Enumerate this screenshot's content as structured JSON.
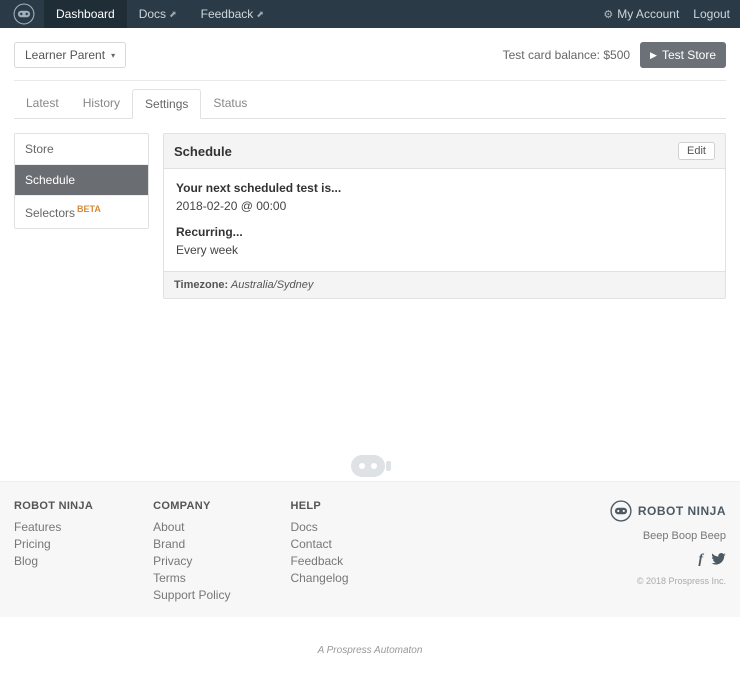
{
  "nav": {
    "dashboard": "Dashboard",
    "docs": "Docs",
    "feedback": "Feedback",
    "my_account": "My Account",
    "logout": "Logout"
  },
  "toprow": {
    "store_selector": "Learner Parent",
    "balance_label": "Test card balance: $500",
    "test_store_btn": "Test Store"
  },
  "tabs": {
    "latest": "Latest",
    "history": "History",
    "settings": "Settings",
    "status": "Status"
  },
  "sidebar": {
    "store": "Store",
    "schedule": "Schedule",
    "selectors": "Selectors",
    "selectors_badge": "BETA"
  },
  "panel": {
    "title": "Schedule",
    "edit": "Edit",
    "next_label": "Your next scheduled test is...",
    "next_value": "2018-02-20 @ 00:00",
    "recurring_label": "Recurring...",
    "recurring_value": "Every week",
    "tz_label": "Timezone:",
    "tz_value": "Australia/Sydney"
  },
  "footer": {
    "col1_title": "ROBOT NINJA",
    "col1": {
      "features": "Features",
      "pricing": "Pricing",
      "blog": "Blog"
    },
    "col2_title": "COMPANY",
    "col2": {
      "about": "About",
      "brand": "Brand",
      "privacy": "Privacy",
      "terms": "Terms",
      "support": "Support Policy"
    },
    "col3_title": "HELP",
    "col3": {
      "docs": "Docs",
      "contact": "Contact",
      "feedback": "Feedback",
      "changelog": "Changelog"
    },
    "brand_name": "ROBOT NINJA",
    "tagline": "Beep Boop Beep",
    "copyright": "© 2018 Prospress Inc."
  },
  "credit": "A Prospress Automaton"
}
